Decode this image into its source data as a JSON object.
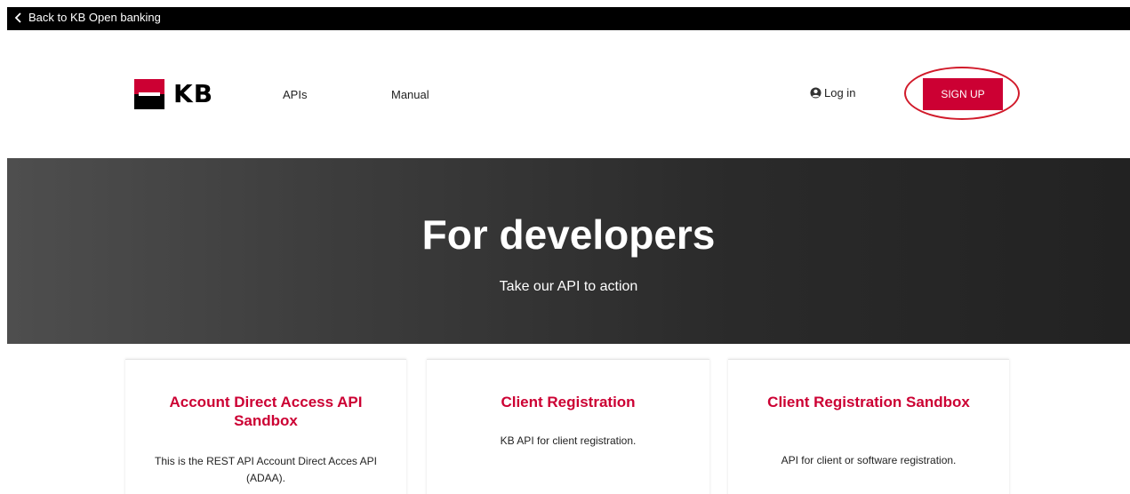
{
  "topbar": {
    "back_label": "Back to KB Open banking"
  },
  "header": {
    "logo_text": "KB",
    "nav": [
      {
        "label": "APIs"
      },
      {
        "label": "Manual"
      }
    ],
    "login_label": "Log in",
    "signup_label": "SIGN UP"
  },
  "hero": {
    "title": "For developers",
    "subtitle": "Take our API to action"
  },
  "cards": [
    {
      "title": "Account Direct Access API Sandbox",
      "description": "This is the REST API Account Direct Acces API (ADAA)."
    },
    {
      "title": "Client Registration",
      "description": "KB API for client registration."
    },
    {
      "title": "Client Registration Sandbox",
      "description": "API for client or software registration."
    }
  ],
  "colors": {
    "brand_red": "#cc0033",
    "highlight_ring": "#d11a2a",
    "topbar": "#000000"
  },
  "icons": {
    "back": "chevron-left-icon",
    "login": "user-circle-icon"
  }
}
